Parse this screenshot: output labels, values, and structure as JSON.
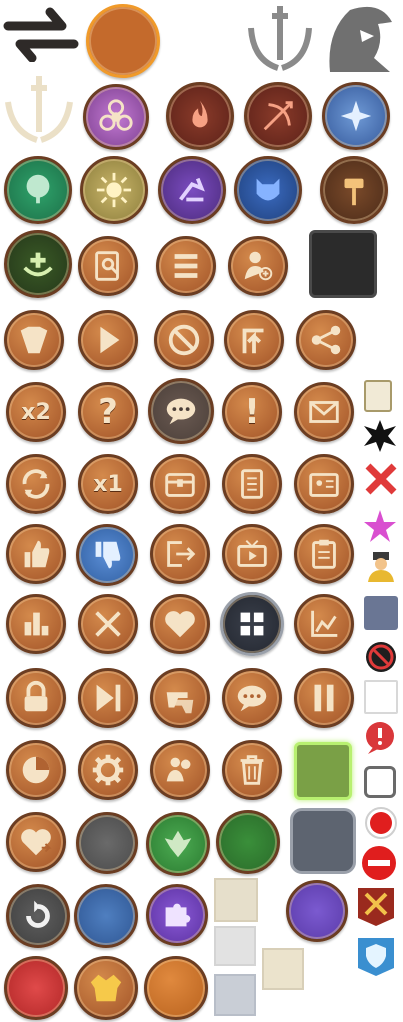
{
  "sheet": {
    "background": "#ffffff"
  },
  "colors": {
    "orange": "#b5682f",
    "cream": "#f5e3c6",
    "dark_brown": "#6b3d22",
    "blue": "#3f6fae",
    "green": "#3f8f3a",
    "purple": "#6a45a8",
    "red": "#c83a3a",
    "gray": "#5e5e5e"
  },
  "labels": {
    "x2": "x2",
    "x1": "x1",
    "question": "?",
    "exclamation": "!"
  }
}
